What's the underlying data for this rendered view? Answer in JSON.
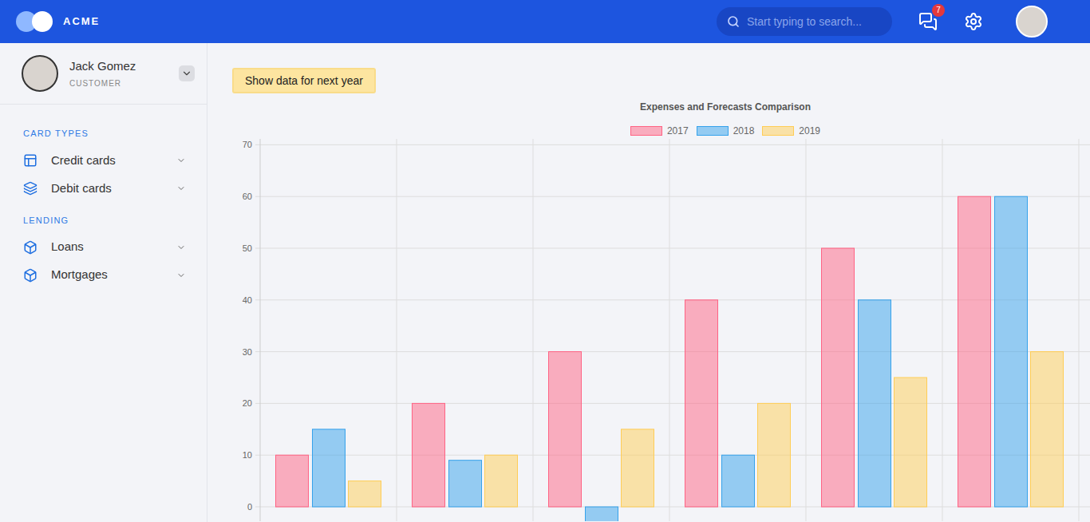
{
  "topbar": {
    "logo_text": "ACME",
    "search": {
      "placeholder": "Start typing to search..."
    },
    "notifications_badge": "7"
  },
  "user": {
    "name": "Jack Gomez",
    "role": "CUSTOMER"
  },
  "sidebar": {
    "sections": [
      {
        "title": "CARD TYPES",
        "items": [
          {
            "label": "Credit cards",
            "icon": "card"
          },
          {
            "label": "Debit cards",
            "icon": "layers"
          }
        ]
      },
      {
        "title": "LENDING",
        "items": [
          {
            "label": "Loans",
            "icon": "box"
          },
          {
            "label": "Mortgages",
            "icon": "box"
          }
        ]
      }
    ]
  },
  "button": {
    "label": "Show data for next year"
  },
  "chart": {
    "title": "Expenses and Forecasts Comparison",
    "y_ticks": [
      "0",
      "10",
      "20",
      "30",
      "40",
      "50",
      "60",
      "70"
    ],
    "series": [
      {
        "label": "2017",
        "color": "#ff6384",
        "values": [
          10,
          20,
          30,
          40,
          50,
          60
        ]
      },
      {
        "label": "2018",
        "color": "#36a2eb",
        "values": [
          15,
          9,
          -10,
          10,
          40,
          60
        ]
      },
      {
        "label": "2019",
        "color": "#ffcd56",
        "values": [
          5,
          10,
          15,
          20,
          25,
          30
        ]
      }
    ]
  }
}
